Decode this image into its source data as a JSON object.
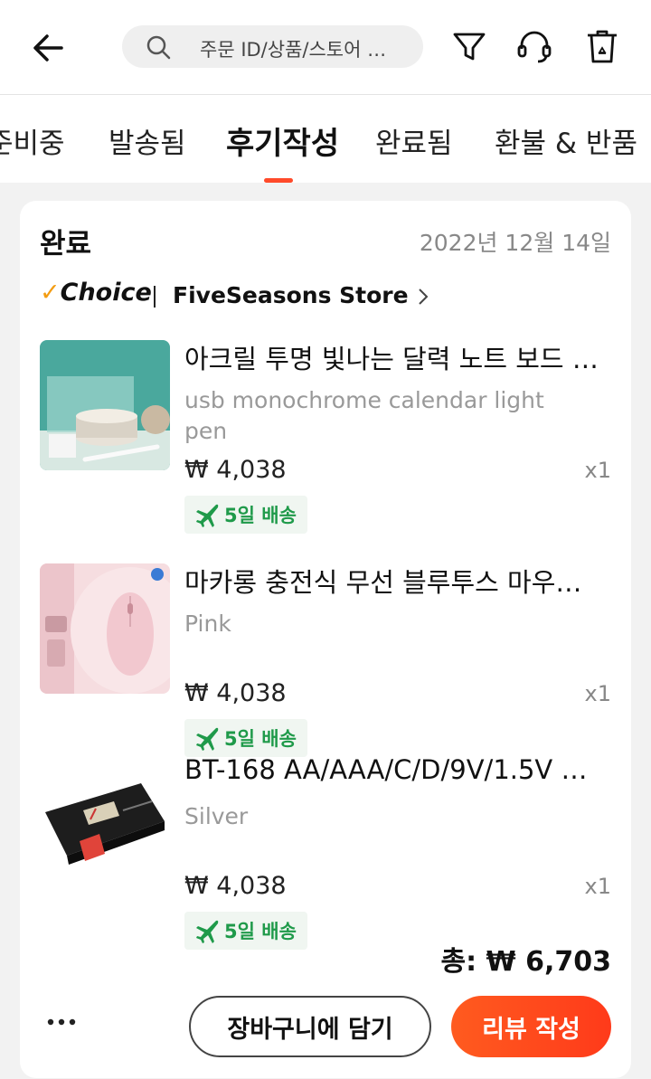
{
  "header": {
    "search_placeholder": "주문 ID/상품/스토어 …",
    "icons": [
      "back-arrow-icon",
      "search-icon",
      "filter-icon",
      "headset-icon",
      "trash-icon"
    ]
  },
  "tabs": [
    {
      "label": "준비중"
    },
    {
      "label": "발송됨"
    },
    {
      "label": "후기작성",
      "active": true
    },
    {
      "label": "완료됨"
    },
    {
      "label": "환불 & 반품"
    }
  ],
  "order": {
    "status": "완료",
    "date": "2022년 12월 14일",
    "choice_label": "Choice",
    "store_name": "FiveSeasons Store",
    "items": [
      {
        "name": "아크릴 투명 빛나는 달력 노트 보드 …",
        "variant": "usb monochrome   calendar light pen",
        "price": "₩ 4,038",
        "qty": "x1",
        "shipping": "5일 배송"
      },
      {
        "name": "마카롱 충전식 무선 블루투스 마우…",
        "variant": "Pink",
        "price": "₩ 4,038",
        "qty": "x1",
        "shipping": "5일 배송"
      },
      {
        "name": "BT-168 AA/AAA/C/D/9V/1.5V …",
        "variant": "Silver",
        "price": "₩ 4,038",
        "qty": "x1",
        "shipping": "5일 배송"
      }
    ],
    "total": "총: ₩ 6,703",
    "cart_button": "장바구니에 담기",
    "review_button": "리뷰 작성"
  },
  "colors": {
    "accent": "#ff4a2a",
    "shipping_green": "#1f9a4a"
  }
}
